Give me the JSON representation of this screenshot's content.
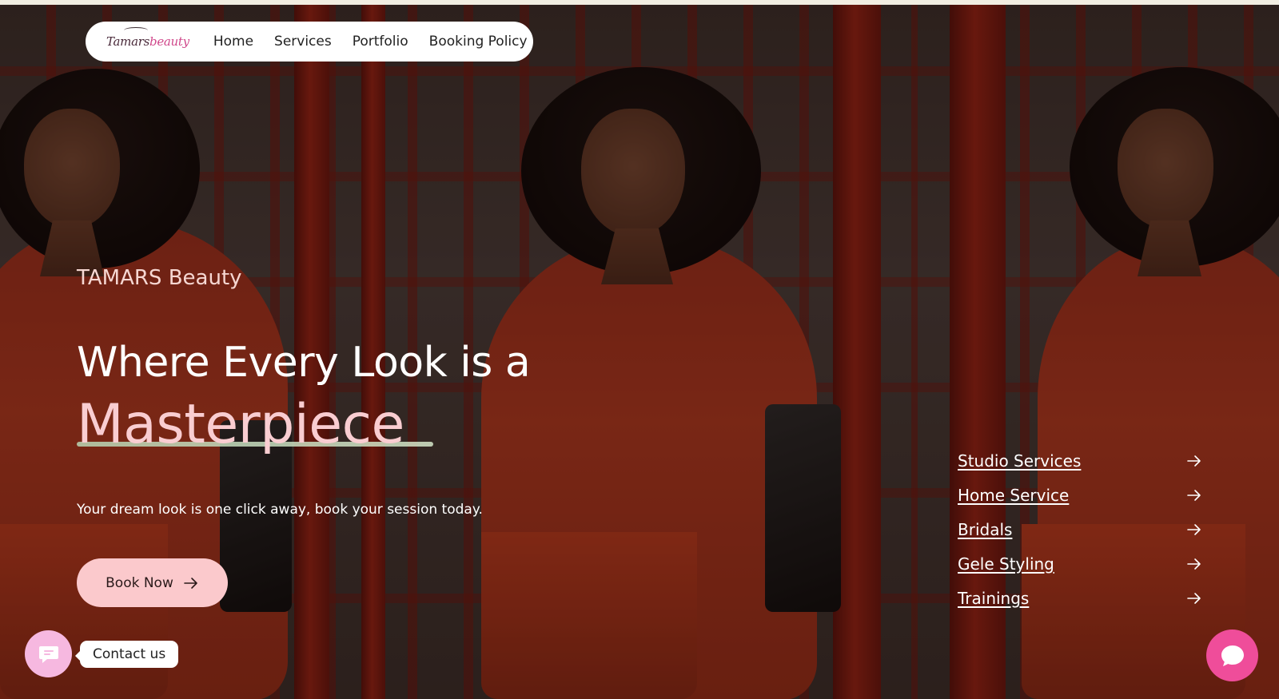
{
  "nav": {
    "logo_text": "Tamars",
    "logo_accent": "beauty",
    "links": [
      "Home",
      "Services",
      "Portfolio",
      "Booking Policy"
    ]
  },
  "hero": {
    "brand": "TAMARS Beauty",
    "headline_line1": "Where Every Look is a",
    "headline_line2": "Masterpiece",
    "subtitle": "Your dream look is one click away, book your session today.",
    "cta_label": "Book Now"
  },
  "services": [
    {
      "label": "Studio Services",
      "icon": "arrow-right-icon"
    },
    {
      "label": "Home Service",
      "icon": "arrow-right-icon"
    },
    {
      "label": "Bridals",
      "icon": "arrow-right-icon"
    },
    {
      "label": "Gele Styling",
      "icon": "arrow-right-icon"
    },
    {
      "label": "Trainings",
      "icon": "arrow-right-icon"
    }
  ],
  "widgets": {
    "contact_label": "Contact us",
    "contact_icon": "message-icon",
    "chat_icon": "chat-bubble-icon"
  },
  "colors": {
    "accent_pink": "#fbc9cc",
    "headline_pink": "#f9cdd1",
    "chat_pink": "#ef4d9a",
    "contact_pink": "#f6b8e0",
    "underline_green": "#b9d5b4"
  }
}
